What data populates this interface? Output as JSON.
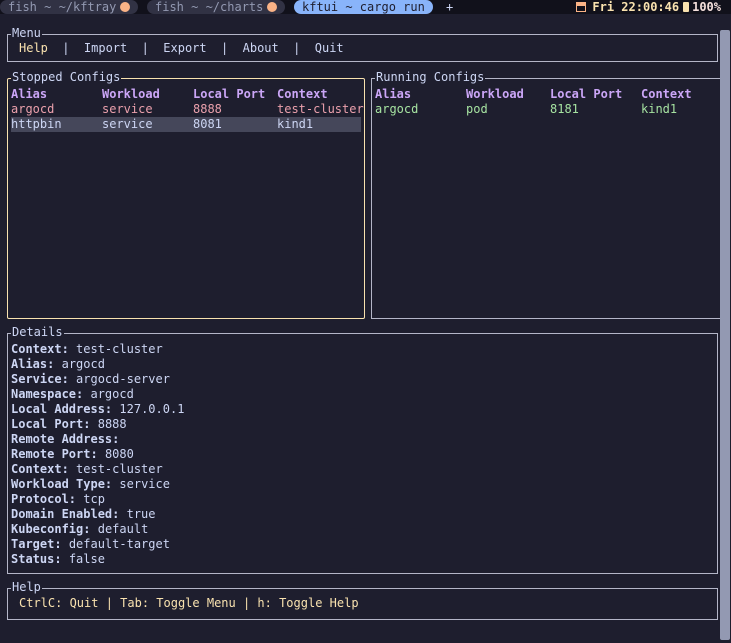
{
  "tabs": [
    {
      "label": "fish ~ ~/kftray",
      "active": false,
      "indicator": true
    },
    {
      "label": "fish ~ ~/charts",
      "active": false,
      "indicator": true
    },
    {
      "label": "kftui ~ cargo run",
      "active": true,
      "indicator": false
    }
  ],
  "new_tab_label": "+",
  "status": {
    "datetime": "Fri 22:00:46",
    "battery": "100%"
  },
  "menu": {
    "title": "Menu",
    "items": [
      "Help",
      "Import",
      "Export",
      "About",
      "Quit"
    ],
    "separator": "|",
    "active": "Help"
  },
  "stopped": {
    "title": "Stopped Configs",
    "headers": [
      "Alias",
      "Workload",
      "Local Port",
      "Context"
    ],
    "rows": [
      [
        "argocd",
        "service",
        "8888",
        "test-cluster"
      ],
      [
        "httpbin",
        "service",
        "8081",
        "kind1"
      ]
    ]
  },
  "running": {
    "title": "Running Configs",
    "headers": [
      "Alias",
      "Workload",
      "Local Port",
      "Context"
    ],
    "rows": [
      [
        "argocd",
        "pod",
        "8181",
        "kind1"
      ]
    ]
  },
  "details": {
    "title": "Details",
    "lines": [
      [
        "Context:",
        "test-cluster"
      ],
      [
        "Alias:",
        "argocd"
      ],
      [
        "Service:",
        "argocd-server"
      ],
      [
        "Namespace:",
        "argocd"
      ],
      [
        "Local Address:",
        "127.0.0.1"
      ],
      [
        "Local Port:",
        "8888"
      ],
      [
        "Remote Address:",
        ""
      ],
      [
        "Remote Port:",
        "8080"
      ],
      [
        "Context:",
        "test-cluster"
      ],
      [
        "Workload Type:",
        "service"
      ],
      [
        "Protocol:",
        "tcp"
      ],
      [
        "Domain Enabled:",
        "true"
      ],
      [
        "Kubeconfig:",
        "default"
      ],
      [
        "Target:",
        "default-target"
      ],
      [
        "Status:",
        "false"
      ]
    ]
  },
  "help": {
    "title": "Help",
    "text": "CtrlC: Quit | Tab: Toggle Menu | h: Toggle Help"
  }
}
